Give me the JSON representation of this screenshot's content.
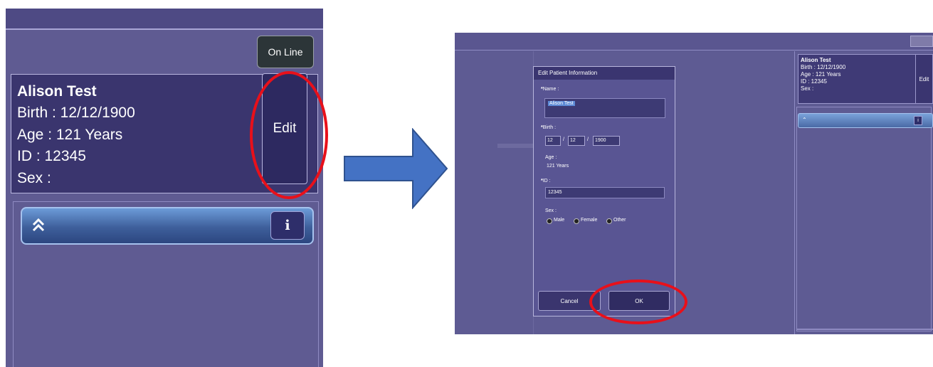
{
  "left_panel": {
    "online_button": "On Line",
    "patient": {
      "name": "Alison Test",
      "birth": "Birth : 12/12/1900",
      "age": "Age : 121 Years",
      "id": "ID : 12345",
      "sex": "Sex :"
    },
    "edit_button": "Edit",
    "info_button": "i",
    "icons": [
      "double-chevron-up-icon"
    ]
  },
  "arrow": {
    "color": "#4472c4"
  },
  "right_panel": {
    "patient_card": {
      "name": "Alison Test",
      "birth": "Birth : 12/12/1900",
      "age": "Age : 121 Years",
      "id": "ID : 12345",
      "sex": "Sex :"
    },
    "edit_button": "Edit",
    "info_button": "i",
    "dialog": {
      "title": "Edit Patient Information",
      "name_label": "Name :",
      "name_value": "Alison Test",
      "birth_label": "Birth :",
      "birth_day": "12",
      "birth_month": "12",
      "birth_year": "1900",
      "age_label": "Age :",
      "age_value": "121 Years",
      "id_label": "ID :",
      "id_value": "12345",
      "sex_label": "Sex :",
      "sex_options": [
        "Male",
        "Female",
        "Other"
      ],
      "cancel_button": "Cancel",
      "ok_button": "OK"
    }
  },
  "annotation_color": "#e8101a"
}
